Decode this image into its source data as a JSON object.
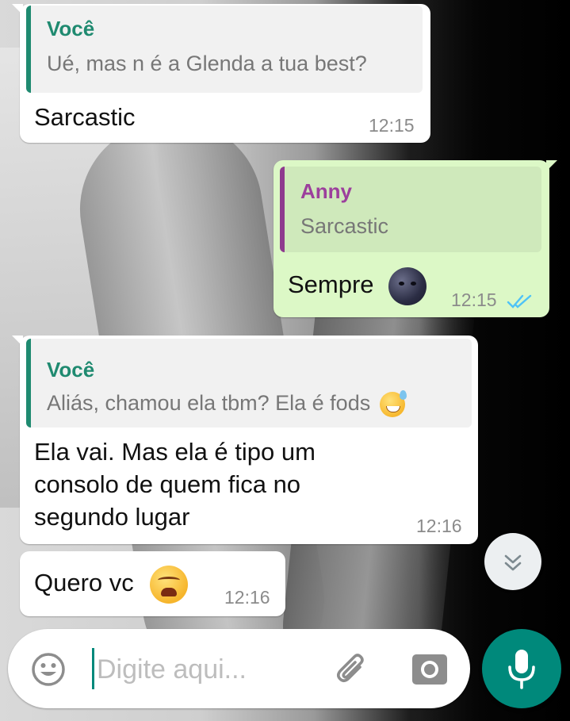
{
  "messages": [
    {
      "direction": "in",
      "quote": {
        "author": "Você",
        "text": "Ué, mas n é a Glenda a tua best?"
      },
      "text": "Sarcastic",
      "time": "12:15"
    },
    {
      "direction": "out",
      "quote": {
        "author": "Anny",
        "text": "Sarcastic"
      },
      "text": "Sempre",
      "emoji": "new-moon-face-emoji",
      "time": "12:15",
      "status": "read"
    },
    {
      "direction": "in",
      "quote": {
        "author": "Você",
        "text": "Aliás, chamou ela tbm? Ela é fods",
        "emoji": "grinning-sweat-emoji"
      },
      "lines": [
        "Ela vai.  Mas ela é tipo um",
        "consolo de quem fica no",
        "segundo lugar"
      ],
      "time": "12:16"
    },
    {
      "direction": "in",
      "text": "Quero vc",
      "emoji": "weary-face-emoji",
      "time": "12:16"
    }
  ],
  "composer": {
    "placeholder": "Digite aqui...",
    "value": ""
  },
  "icons": {
    "emoji_button": "smiley-icon",
    "attach_button": "paperclip-icon",
    "camera_button": "camera-icon",
    "voice_button": "microphone-icon",
    "scroll_button": "double-chevron-down-icon",
    "read_receipt": "double-check-icon"
  },
  "colors": {
    "incoming_bubble": "#ffffff",
    "outgoing_bubble": "#dcf8c6",
    "self_name": "#1f8a70",
    "anny_name": "#9c3f9c",
    "quote_bar_self": "#1f8a70",
    "quote_bar_anny": "#8e3a8e",
    "accent": "#00897b",
    "read_ticks": "#4fc3f7"
  }
}
